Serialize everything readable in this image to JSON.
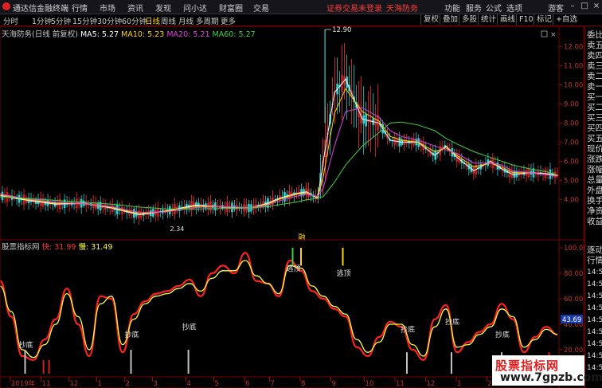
{
  "titlebar": {
    "app_title": "通达信金融终端",
    "menu": [
      "行情",
      "市场",
      "资讯",
      "发现",
      "问小达",
      "财富圈",
      "交易"
    ],
    "notice": "证券交易未登录",
    "stock_name": "天海防务",
    "right_menu": [
      "功能",
      "服务",
      "公式",
      "选项"
    ],
    "user": "游客"
  },
  "toolbar": {
    "periods": [
      "分时",
      "1分钟",
      "5分钟",
      "15分钟",
      "30分钟",
      "60分钟",
      "日线",
      "周线",
      "月线",
      "多周期",
      "更多"
    ],
    "active_period": "日线",
    "buttons": [
      "复权",
      "叠加",
      "多股",
      "统计",
      "画线",
      "F10",
      "标记",
      "+自选"
    ]
  },
  "main_chart": {
    "title": "天海防务(日线 前复权)",
    "ma5": "MA5: 5.27",
    "ma10": "MA10: 5.23",
    "ma20": "MA20: 5.21",
    "ma60": "MA60: 5.27",
    "high_marker": "12.90",
    "low_marker": "2.34",
    "event_tag": "融"
  },
  "indicator": {
    "title": "股票指标网",
    "fast": "快: 31.99",
    "slow": "慢: 31.49",
    "current_value": "43.69",
    "labels": [
      "抄底",
      "抄底",
      "抄底",
      "逃顶",
      "逃顶",
      "抄底",
      "抄底",
      "抄底"
    ]
  },
  "x_axis": {
    "labels": [
      "2019年",
      "11",
      "12",
      "1",
      "2",
      "3",
      "4",
      "5",
      "6",
      "7",
      "8",
      "9",
      "10",
      "11",
      "12",
      "1",
      "2",
      "3"
    ]
  },
  "chart_data": [
    {
      "type": "candlestick",
      "title": "天海防务(日线 前复权)",
      "y_ticks": [
        4.0,
        5.0,
        6.0,
        7.0,
        8.0,
        9.0,
        10.0,
        11.0,
        12.0
      ],
      "ylim": [
        2.3,
        12.9
      ],
      "series": [
        {
          "name": "MA5",
          "color": "#ffffff",
          "x": [
            0,
            5,
            10,
            15,
            20,
            25,
            30,
            35,
            40,
            45,
            48,
            50,
            53,
            55,
            57,
            58,
            60,
            62,
            65,
            68,
            70,
            72,
            75,
            78,
            80,
            82,
            85,
            88,
            90,
            92,
            95,
            98,
            100
          ],
          "y": [
            4.2,
            3.95,
            3.75,
            3.8,
            3.55,
            3.2,
            3.4,
            3.7,
            3.6,
            3.55,
            3.8,
            4.05,
            4.3,
            4.4,
            4.05,
            6.0,
            9.6,
            10.3,
            8.2,
            8.0,
            7.1,
            7.0,
            7.0,
            6.3,
            6.8,
            6.2,
            5.5,
            6.0,
            5.6,
            5.3,
            5.4,
            5.35,
            5.27
          ]
        },
        {
          "name": "MA10",
          "color": "#ffd400",
          "x": [
            0,
            5,
            10,
            15,
            20,
            25,
            30,
            35,
            40,
            45,
            48,
            50,
            53,
            55,
            57,
            58,
            60,
            62,
            65,
            68,
            70,
            72,
            75,
            78,
            80,
            82,
            85,
            88,
            90,
            92,
            95,
            98,
            100
          ],
          "y": [
            4.25,
            3.98,
            3.8,
            3.78,
            3.58,
            3.25,
            3.38,
            3.65,
            3.62,
            3.55,
            3.75,
            4.0,
            4.25,
            4.35,
            4.1,
            5.2,
            8.5,
            9.8,
            8.6,
            8.1,
            7.3,
            7.1,
            7.0,
            6.5,
            6.7,
            6.3,
            5.7,
            5.9,
            5.7,
            5.4,
            5.4,
            5.3,
            5.23
          ]
        },
        {
          "name": "MA20",
          "color": "#e040e0",
          "x": [
            0,
            5,
            10,
            15,
            20,
            25,
            30,
            35,
            40,
            45,
            48,
            50,
            53,
            55,
            57,
            58,
            60,
            62,
            65,
            68,
            70,
            72,
            75,
            78,
            80,
            82,
            85,
            88,
            90,
            92,
            95,
            98,
            100
          ],
          "y": [
            4.28,
            4.02,
            3.85,
            3.78,
            3.62,
            3.32,
            3.35,
            3.58,
            3.62,
            3.56,
            3.7,
            3.92,
            4.15,
            4.28,
            4.15,
            4.6,
            6.8,
            8.6,
            8.8,
            8.3,
            7.6,
            7.3,
            7.1,
            6.8,
            6.6,
            6.4,
            5.9,
            5.9,
            5.8,
            5.5,
            5.4,
            5.3,
            5.21
          ]
        },
        {
          "name": "MA60",
          "color": "#40d040",
          "x": [
            0,
            5,
            10,
            15,
            20,
            25,
            30,
            35,
            40,
            45,
            48,
            50,
            53,
            55,
            57,
            58,
            60,
            62,
            65,
            68,
            70,
            72,
            75,
            78,
            80,
            82,
            85,
            88,
            90,
            92,
            95,
            98,
            100
          ],
          "y": [
            4.15,
            4.05,
            3.95,
            3.85,
            3.75,
            3.6,
            3.5,
            3.5,
            3.52,
            3.55,
            3.62,
            3.72,
            3.85,
            3.98,
            4.05,
            4.15,
            4.9,
            5.8,
            6.8,
            7.5,
            8.0,
            8.05,
            7.9,
            7.6,
            7.2,
            6.9,
            6.5,
            6.2,
            6.0,
            5.8,
            5.6,
            5.45,
            5.27
          ]
        }
      ]
    },
    {
      "type": "line",
      "title": "股票指标网",
      "y_ticks": [
        20.0,
        40.0,
        60.0,
        80.0,
        100.0
      ],
      "ylim": [
        0,
        105
      ],
      "series": [
        {
          "name": "快",
          "color": "#ff2020",
          "x": [
            0,
            2,
            4,
            6,
            8,
            10,
            12,
            14,
            16,
            18,
            20,
            22,
            24,
            26,
            28,
            30,
            32,
            34,
            36,
            38,
            40,
            42,
            44,
            46,
            48,
            50,
            52,
            54,
            56,
            58,
            60,
            62,
            64,
            66,
            68,
            70,
            72,
            74,
            76,
            78,
            80,
            82,
            84,
            86,
            88,
            90,
            92,
            94,
            96,
            98,
            100
          ],
          "y": [
            74,
            46,
            15,
            12,
            28,
            44,
            68,
            40,
            15,
            62,
            60,
            18,
            48,
            58,
            64,
            66,
            70,
            75,
            62,
            80,
            86,
            80,
            96,
            74,
            72,
            62,
            90,
            82,
            66,
            60,
            52,
            46,
            22,
            15,
            30,
            42,
            38,
            20,
            12,
            44,
            55,
            18,
            26,
            34,
            40,
            56,
            44,
            18,
            30,
            38,
            32
          ]
        },
        {
          "name": "慢",
          "color": "#ffff40",
          "x": [
            0,
            2,
            4,
            6,
            8,
            10,
            12,
            14,
            16,
            18,
            20,
            22,
            24,
            26,
            28,
            30,
            32,
            34,
            36,
            38,
            40,
            42,
            44,
            46,
            48,
            50,
            52,
            54,
            56,
            58,
            60,
            62,
            64,
            66,
            68,
            70,
            72,
            74,
            76,
            78,
            80,
            82,
            84,
            86,
            88,
            90,
            92,
            94,
            96,
            98,
            100
          ],
          "y": [
            70,
            50,
            20,
            14,
            24,
            40,
            64,
            46,
            20,
            56,
            62,
            24,
            44,
            56,
            62,
            64,
            68,
            72,
            66,
            76,
            82,
            82,
            90,
            78,
            72,
            64,
            86,
            84,
            70,
            62,
            54,
            48,
            28,
            18,
            26,
            40,
            40,
            24,
            15,
            38,
            52,
            22,
            24,
            32,
            38,
            52,
            46,
            22,
            28,
            36,
            32
          ]
        }
      ]
    }
  ]
}
